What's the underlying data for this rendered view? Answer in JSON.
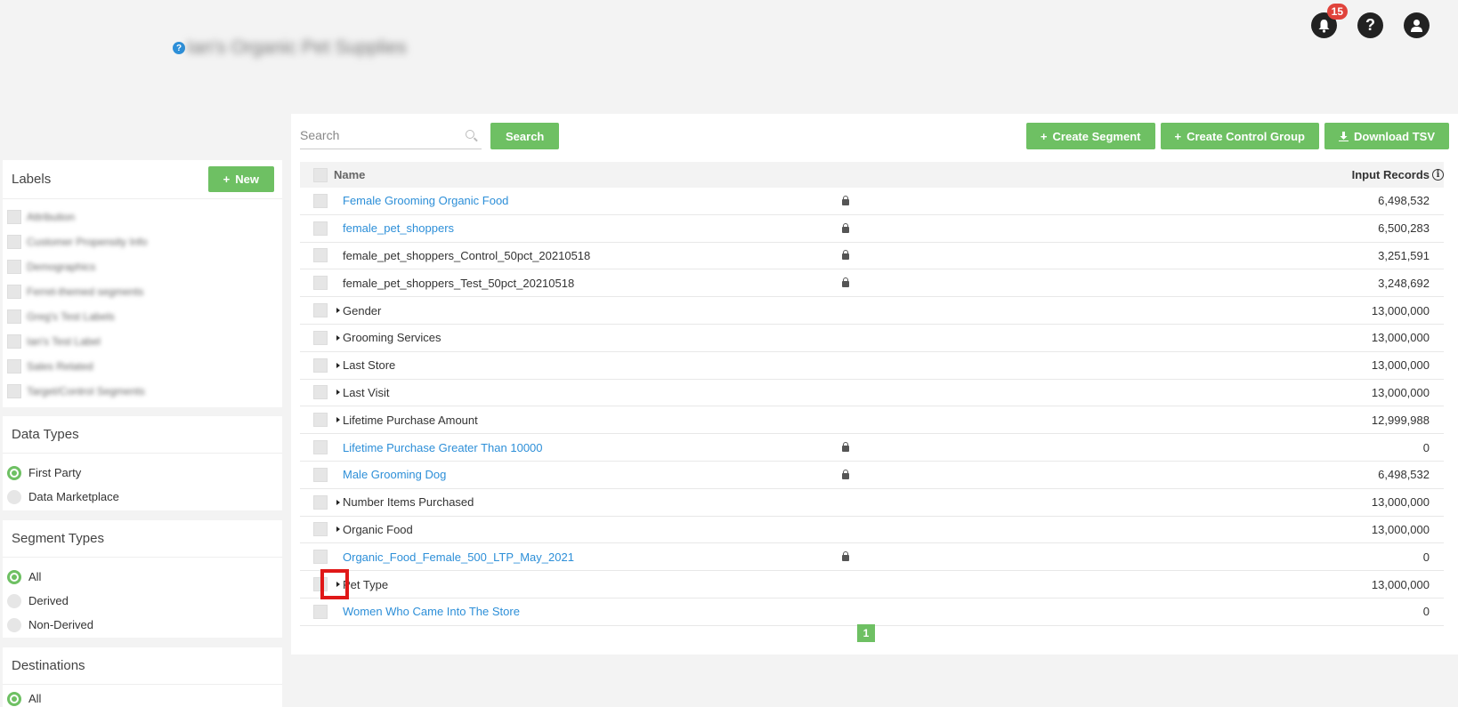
{
  "header": {
    "account_name": "Ian's Organic Pet Supplies",
    "help_glyph": "?",
    "notification_count": "15"
  },
  "labels": {
    "title": "Labels",
    "new_button": "New",
    "items": [
      {
        "label": "Attribution"
      },
      {
        "label": "Customer Propensity Info"
      },
      {
        "label": "Demographics"
      },
      {
        "label": "Ferret-themed segments"
      },
      {
        "label": "Greg's Test Labels"
      },
      {
        "label": "Ian's Test Label"
      },
      {
        "label": "Sales Related"
      },
      {
        "label": "Target/Control Segments"
      }
    ]
  },
  "data_types": {
    "title": "Data Types",
    "options": [
      {
        "label": "First Party",
        "selected": true
      },
      {
        "label": "Data Marketplace",
        "selected": false
      }
    ]
  },
  "segment_types": {
    "title": "Segment Types",
    "options": [
      {
        "label": "All",
        "selected": true
      },
      {
        "label": "Derived",
        "selected": false
      },
      {
        "label": "Non-Derived",
        "selected": false
      }
    ]
  },
  "destinations": {
    "title": "Destinations",
    "options": [
      {
        "label": "All",
        "selected": true
      }
    ]
  },
  "toolbar": {
    "search_placeholder": "Search",
    "search_button": "Search",
    "create_segment": "Create Segment",
    "create_control_group": "Create Control Group",
    "download_tsv": "Download TSV"
  },
  "table": {
    "col_name": "Name",
    "col_records": "Input Records",
    "rows": [
      {
        "name": "Female Grooming Organic Food",
        "kind": "link",
        "locked": true,
        "records": "6,498,532"
      },
      {
        "name": "female_pet_shoppers",
        "kind": "link",
        "locked": true,
        "records": "6,500,283"
      },
      {
        "name": "female_pet_shoppers_Control_50pct_20210518",
        "kind": "plain",
        "locked": true,
        "records": "3,251,591"
      },
      {
        "name": "female_pet_shoppers_Test_50pct_20210518",
        "kind": "plain",
        "locked": true,
        "records": "3,248,692"
      },
      {
        "name": "Gender",
        "kind": "folder",
        "locked": false,
        "records": "13,000,000"
      },
      {
        "name": "Grooming Services",
        "kind": "folder",
        "locked": false,
        "records": "13,000,000"
      },
      {
        "name": "Last Store",
        "kind": "folder",
        "locked": false,
        "records": "13,000,000"
      },
      {
        "name": "Last Visit",
        "kind": "folder",
        "locked": false,
        "records": "13,000,000"
      },
      {
        "name": "Lifetime Purchase Amount",
        "kind": "folder",
        "locked": false,
        "records": "12,999,988"
      },
      {
        "name": "Lifetime Purchase Greater Than 10000",
        "kind": "link",
        "locked": true,
        "records": "0"
      },
      {
        "name": "Male Grooming Dog",
        "kind": "link",
        "locked": true,
        "records": "6,498,532"
      },
      {
        "name": "Number Items Purchased",
        "kind": "folder",
        "locked": false,
        "records": "13,000,000"
      },
      {
        "name": "Organic Food",
        "kind": "folder",
        "locked": false,
        "records": "13,000,000"
      },
      {
        "name": "Organic_Food_Female_500_LTP_May_2021",
        "kind": "link",
        "locked": true,
        "records": "0"
      },
      {
        "name": "Pet Type",
        "kind": "folder",
        "locked": false,
        "records": "13,000,000",
        "highlighted": true
      },
      {
        "name": "Women Who Came Into The Store",
        "kind": "link",
        "locked": false,
        "records": "0"
      }
    ]
  },
  "pagination": {
    "current": "1"
  },
  "colors": {
    "accent": "#6ec063",
    "link": "#2d8fd8",
    "badge": "#e0433b",
    "highlight": "#e01818"
  }
}
